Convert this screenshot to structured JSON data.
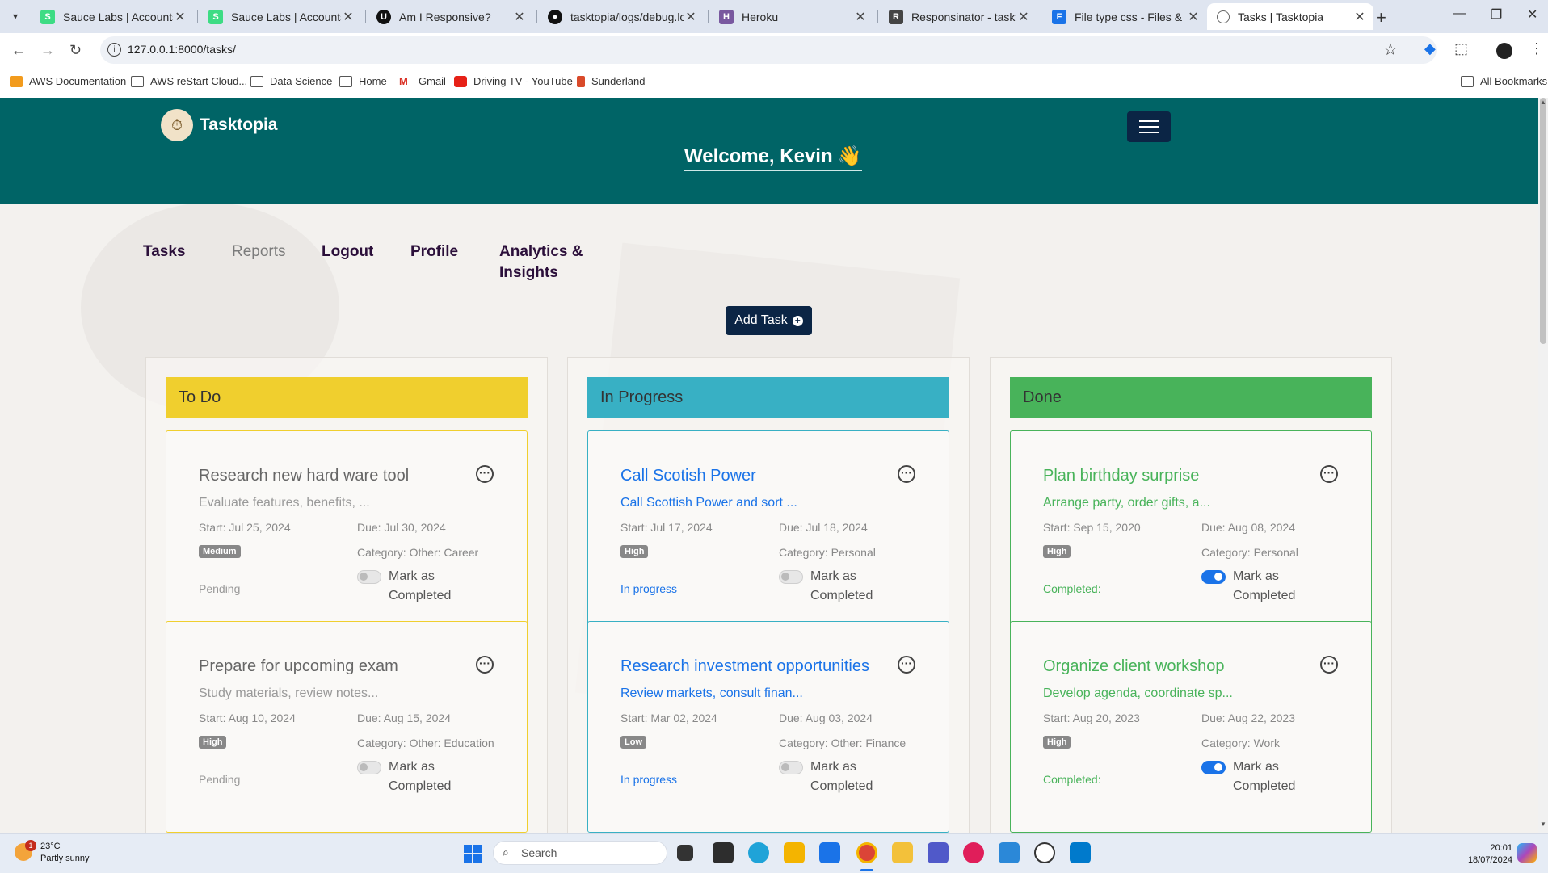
{
  "browser": {
    "tabs": [
      {
        "title": "Sauce Labs | Accounts",
        "favicon": "sauce-labs-icon",
        "color": "#3ddc84",
        "active": false
      },
      {
        "title": "Sauce Labs | Accounts",
        "favicon": "sauce-labs-icon",
        "color": "#3ddc84",
        "active": false
      },
      {
        "title": "Am I Responsive?",
        "favicon": "amiresponsive-icon",
        "color": "#111111",
        "active": false
      },
      {
        "title": "tasktopia/logs/debug.log",
        "favicon": "github-icon",
        "color": "#111111",
        "active": false
      },
      {
        "title": "Heroku",
        "favicon": "heroku-icon",
        "color": "#79589f",
        "active": false
      },
      {
        "title": "Responsinator - tasktopia",
        "favicon": "responsinator-icon",
        "color": "#444444",
        "active": false
      },
      {
        "title": "File type css - Files & Folders",
        "favicon": "filetype-icon",
        "color": "#1a73e8",
        "active": false
      },
      {
        "title": "Tasks | Tasktopia",
        "favicon": "globe-icon",
        "color": "#666666",
        "active": true
      }
    ],
    "url": "127.0.0.1:8000/tasks/",
    "bookmarks": [
      {
        "label": "AWS Documentation",
        "icon": "aws-icon"
      },
      {
        "label": "AWS reStart Cloud...",
        "icon": "folder-icon"
      },
      {
        "label": "Data Science",
        "icon": "folder-icon"
      },
      {
        "label": "Home",
        "icon": "folder-icon"
      },
      {
        "label": "Gmail",
        "icon": "gmail-icon"
      },
      {
        "label": "Driving TV - YouTube",
        "icon": "youtube-icon"
      },
      {
        "label": "Sunderland",
        "icon": "sunderland-icon"
      }
    ],
    "all_bookmarks": "All Bookmarks"
  },
  "app": {
    "brand": "Tasktopia",
    "welcome": "Welcome, Kevin",
    "welcome_emoji": "👋",
    "nav": [
      {
        "label": "Tasks",
        "muted": false
      },
      {
        "label": "Reports",
        "muted": true
      },
      {
        "label": "Logout",
        "muted": false
      },
      {
        "label": "Profile",
        "muted": false
      },
      {
        "label": "Analytics & Insights",
        "muted": false
      }
    ],
    "add_task": "Add Task",
    "colors": {
      "header": "#006466",
      "navy": "#0b2545",
      "todo": "#f0cf2e",
      "inprogress": "#38b0c4",
      "done": "#48b35a",
      "todo_text": "#666666",
      "inprogress_text": "#1a73e8",
      "done_text": "#48b35a"
    },
    "columns": [
      {
        "key": "todo",
        "title": "To Do",
        "cards": [
          {
            "title": "Research new hard ware tool",
            "description": "Evaluate features, benefits, ...",
            "start": "Start: Jul 25, 2024",
            "due": "Due: Jul 30, 2024",
            "priority": "Medium",
            "category": "Category: Other: Career",
            "status": "Pending",
            "completed": false,
            "mark_label": "Mark as Completed"
          },
          {
            "title": "Prepare for upcoming exam",
            "description": "Study materials, review notes...",
            "start": "Start: Aug 10, 2024",
            "due": "Due: Aug 15, 2024",
            "priority": "High",
            "category": "Category: Other: Education",
            "status": "Pending",
            "completed": false,
            "mark_label": "Mark as Completed"
          }
        ]
      },
      {
        "key": "inprogress",
        "title": "In Progress",
        "cards": [
          {
            "title": "Call Scotish Power",
            "description": "Call Scottish Power and sort ...",
            "start": "Start: Jul 17, 2024",
            "due": "Due: Jul 18, 2024",
            "priority": "High",
            "category": "Category: Personal",
            "status": "In progress",
            "completed": false,
            "mark_label": "Mark as Completed"
          },
          {
            "title": "Research investment opportunities",
            "description": "Review markets, consult finan...",
            "start": "Start: Mar 02, 2024",
            "due": "Due: Aug 03, 2024",
            "priority": "Low",
            "category": "Category: Other: Finance",
            "status": "In progress",
            "completed": false,
            "mark_label": "Mark as Completed"
          }
        ]
      },
      {
        "key": "done",
        "title": "Done",
        "cards": [
          {
            "title": "Plan birthday surprise",
            "description": "Arrange party, order gifts, a...",
            "start": "Start: Sep 15, 2020",
            "due": "Due: Aug 08, 2024",
            "priority": "High",
            "category": "Category: Personal",
            "status": "Completed:",
            "completed": true,
            "mark_label": "Mark as Completed"
          },
          {
            "title": "Organize client workshop",
            "description": "Develop agenda, coordinate sp...",
            "start": "Start: Aug 20, 2023",
            "due": "Due: Aug 22, 2023",
            "priority": "High",
            "category": "Category: Work",
            "status": "Completed:",
            "completed": true,
            "mark_label": "Mark as Completed"
          }
        ]
      }
    ]
  },
  "taskbar": {
    "weather_temp": "23°C",
    "weather_desc": "Partly sunny",
    "weather_badge": "1",
    "search_placeholder": "Search",
    "time": "20:01",
    "date": "18/07/2024"
  }
}
